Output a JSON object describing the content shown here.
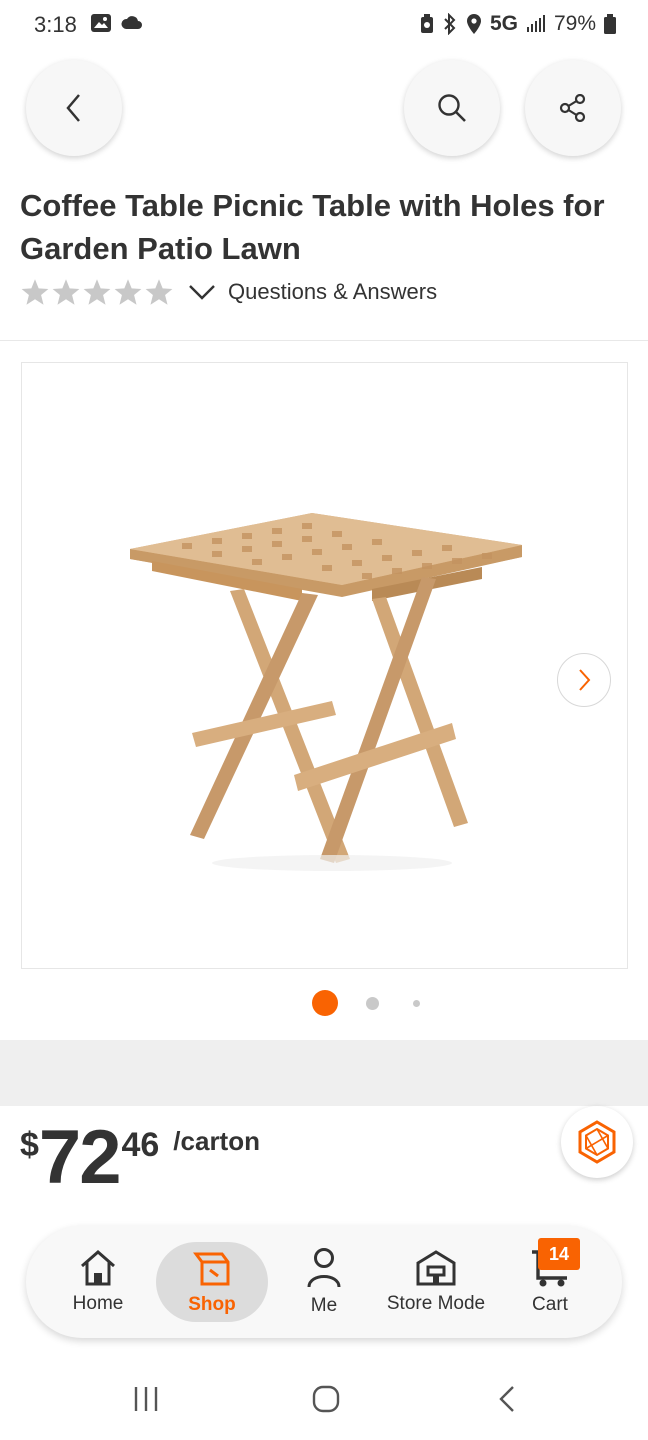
{
  "status_bar": {
    "time": "3:18",
    "network": "5G",
    "battery": "79%",
    "icons": [
      "image-icon",
      "cloud-icon",
      "battery-saver-icon",
      "bluetooth-icon",
      "location-icon",
      "signal-icon",
      "battery-icon"
    ]
  },
  "header": {
    "back_icon": "chevron-left-icon",
    "search_icon": "search-icon",
    "share_icon": "share-icon"
  },
  "product": {
    "title": "Coffee Table Picnic Table with Holes for Garden Patio Lawn",
    "rating_stars": 0,
    "rating_max": 5,
    "qa_label": "Questions & Answers",
    "image_index": 1,
    "image_count": 3
  },
  "price": {
    "dollar_sign": "$",
    "whole": "72",
    "cents": "46",
    "unit": "/carton"
  },
  "bottom_nav": {
    "items": [
      {
        "label": "Home",
        "icon": "home-icon"
      },
      {
        "label": "Shop",
        "icon": "shop-icon",
        "active": true
      },
      {
        "label": "Me",
        "icon": "person-icon"
      },
      {
        "label": "Store Mode",
        "icon": "store-icon"
      },
      {
        "label": "Cart",
        "icon": "cart-icon"
      }
    ],
    "cart_count": "14"
  },
  "colors": {
    "accent": "#f96302",
    "text": "#333333",
    "star_empty": "#c8c8c8"
  }
}
